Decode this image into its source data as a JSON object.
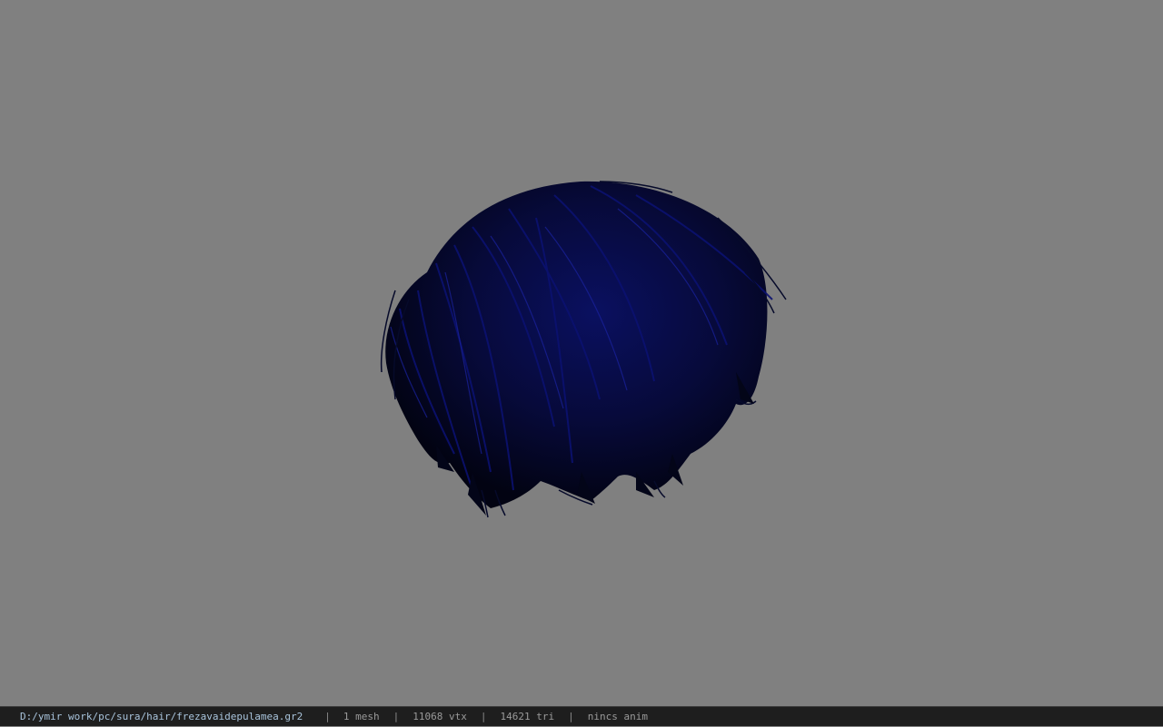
{
  "viewer": {
    "background_color": "#808080",
    "model_name_icon": "hair-mesh",
    "model_color": "#0a0f4a"
  },
  "statusbar": {
    "file_path": "D:/ymir work/pc/sura/hair/frezavaidepulamea.gr2",
    "separator": "|",
    "mesh_count": "1 mesh",
    "vertex_count": "11068 vtx",
    "triangle_count": "14621 tri",
    "anim_status": "nincs anim"
  }
}
